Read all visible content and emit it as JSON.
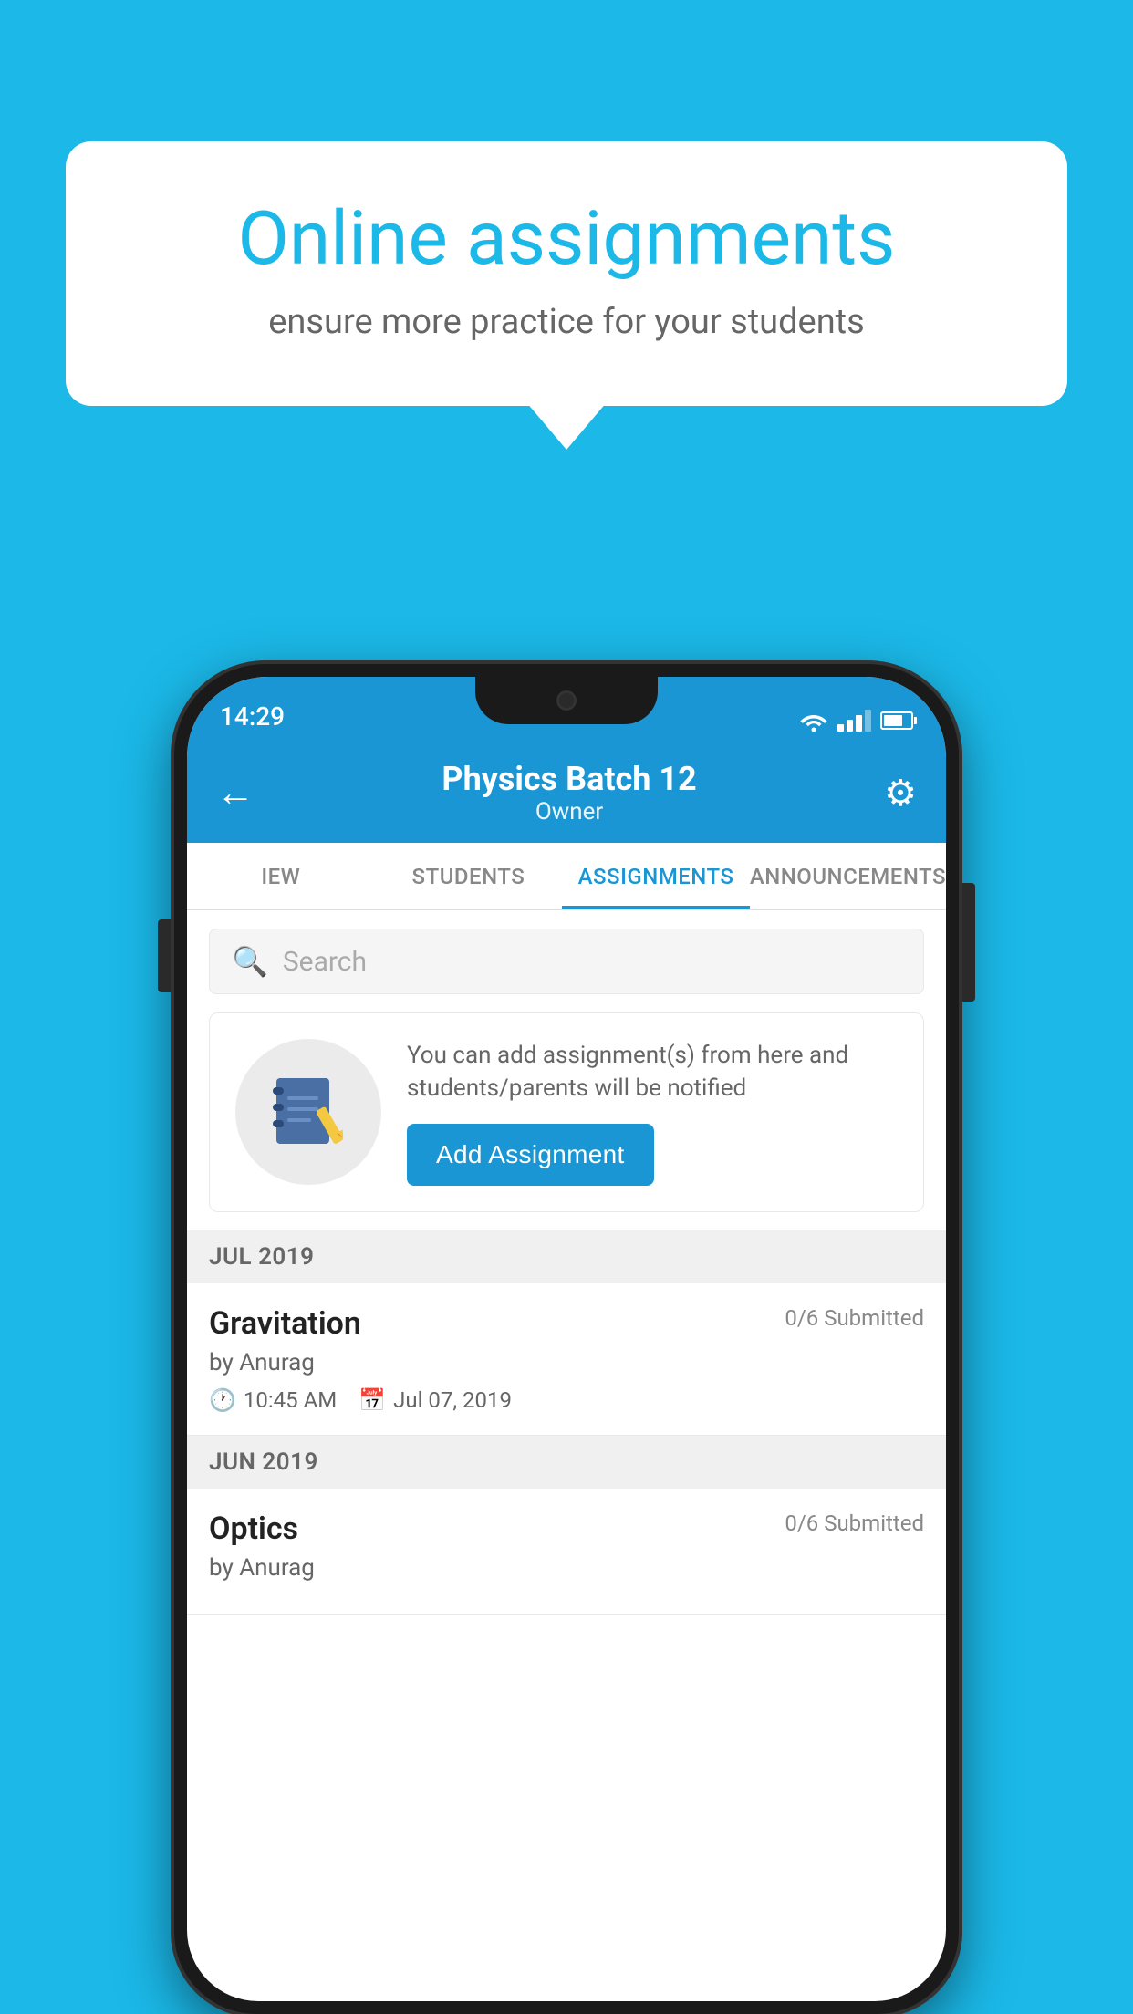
{
  "background_color": "#1bb8e8",
  "speech_bubble": {
    "title": "Online assignments",
    "subtitle": "ensure more practice for your students"
  },
  "phone": {
    "status_bar": {
      "time": "14:29"
    },
    "header": {
      "title": "Physics Batch 12",
      "subtitle": "Owner",
      "back_label": "←",
      "settings_label": "⚙"
    },
    "tabs": [
      {
        "label": "IEW",
        "active": false
      },
      {
        "label": "STUDENTS",
        "active": false
      },
      {
        "label": "ASSIGNMENTS",
        "active": true
      },
      {
        "label": "ANNOUNCEMENTS",
        "active": false
      }
    ],
    "search": {
      "placeholder": "Search"
    },
    "promo": {
      "text": "You can add assignment(s) from here and students/parents will be notified",
      "button_label": "Add Assignment"
    },
    "sections": [
      {
        "title": "JUL 2019",
        "assignments": [
          {
            "name": "Gravitation",
            "submitted": "0/6 Submitted",
            "by": "by Anurag",
            "time": "10:45 AM",
            "date": "Jul 07, 2019"
          }
        ]
      },
      {
        "title": "JUN 2019",
        "assignments": [
          {
            "name": "Optics",
            "submitted": "0/6 Submitted",
            "by": "by Anurag",
            "time": "",
            "date": ""
          }
        ]
      }
    ]
  }
}
